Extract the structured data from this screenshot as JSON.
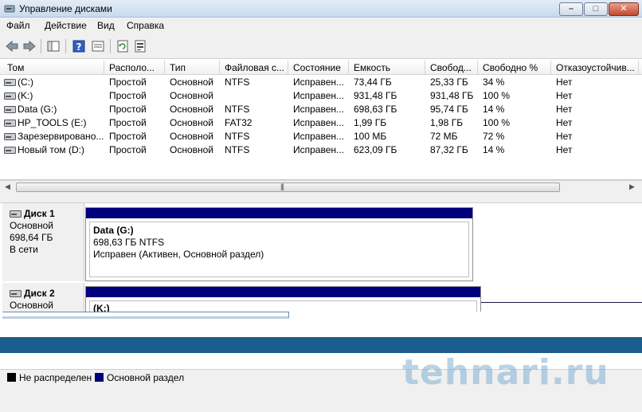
{
  "window": {
    "title": "Управление дисками"
  },
  "menu": [
    "Файл",
    "Действие",
    "Вид",
    "Справка"
  ],
  "toolbar": {
    "icons": [
      "back-arrow-icon",
      "forward-arrow-icon",
      "console-tree-icon",
      "help-icon",
      "refresh-icon",
      "properties-icon"
    ]
  },
  "table": {
    "columns": [
      "Том",
      "Располо...",
      "Тип",
      "Файловая с...",
      "Состояние",
      "Емкость",
      "Свобод...",
      "Свободно %",
      "Отказоустойчив..."
    ],
    "rows": [
      [
        "(C:)",
        "Простой",
        "Основной",
        "NTFS",
        "Исправен...",
        "73,44 ГБ",
        "25,33 ГБ",
        "34 %",
        "Нет"
      ],
      [
        "(K:)",
        "Простой",
        "Основной",
        "",
        "Исправен...",
        "931,48 ГБ",
        "931,48 ГБ",
        "100 %",
        "Нет"
      ],
      [
        "Data (G:)",
        "Простой",
        "Основной",
        "NTFS",
        "Исправен...",
        "698,63 ГБ",
        "95,74 ГБ",
        "14 %",
        "Нет"
      ],
      [
        "HP_TOOLS (E:)",
        "Простой",
        "Основной",
        "FAT32",
        "Исправен...",
        "1,99 ГБ",
        "1,98 ГБ",
        "100 %",
        "Нет"
      ],
      [
        "Зарезервировано...",
        "Простой",
        "Основной",
        "NTFS",
        "Исправен...",
        "100 МБ",
        "72 МБ",
        "72 %",
        "Нет"
      ],
      [
        "Новый том (D:)",
        "Простой",
        "Основной",
        "NTFS",
        "Исправен...",
        "623,09 ГБ",
        "87,32 ГБ",
        "14 %",
        "Нет"
      ]
    ]
  },
  "disks": [
    {
      "name": "Диск 1",
      "type": "Основной",
      "size": "698,64 ГБ",
      "status": "В сети",
      "partition": {
        "name": "Data  (G:)",
        "size": "698,63 ГБ NTFS",
        "state": "Исправен (Активен, Основной раздел)"
      }
    },
    {
      "name": "Диск 2",
      "type": "Основной",
      "partition": {
        "name": "(K:)"
      }
    }
  ],
  "legend": [
    {
      "label": "Не распределен",
      "color": "#000000"
    },
    {
      "label": "Основной раздел",
      "color": "#00007d"
    }
  ],
  "watermark": "tehnari.ru"
}
